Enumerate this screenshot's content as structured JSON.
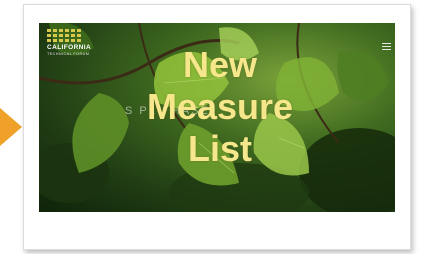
{
  "site": {
    "logo_title": "CALIFORNIA",
    "logo_subtitle": "TECHNICAL FORUM",
    "hero_text": "S          PLU  HASE"
  },
  "overlay": {
    "line1": "New",
    "line2": "Measure",
    "line3": "List"
  },
  "colors": {
    "arrow": "#f0a12a",
    "overlay_text": "#f6e78c",
    "logo_dots": "#d6c84d"
  },
  "icons": {
    "menu": "hamburger-menu-icon",
    "pointer": "arrow-right-icon"
  }
}
